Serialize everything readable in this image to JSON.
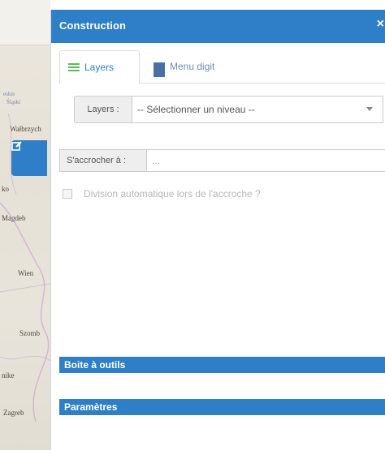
{
  "panel": {
    "title": "Construction",
    "close": "×"
  },
  "tabs": [
    {
      "label": "Layers",
      "icon": "layers-icon",
      "active": true
    },
    {
      "label": "Menu digit",
      "icon": "grid-icon",
      "active": false
    }
  ],
  "layers_field": {
    "label": "Layers :",
    "selected": "-- Sélectionner un niveau --"
  },
  "snap_field": {
    "label": "S'accrocher à :",
    "value": "..."
  },
  "auto_split": {
    "label": "Division automatique lors de l'accroche ?",
    "checked": false
  },
  "sections": {
    "toolbox": "Boite à outils",
    "params": "Paramètres"
  },
  "map": {
    "labels": [
      "Wałbrzych",
      "ko",
      "Magdeb",
      "Wien",
      "Szomb",
      "nike",
      "Zagreb"
    ],
    "tile_text": [
      "eskie",
      "Śląski"
    ],
    "edit_icon": "edit-icon"
  },
  "colors": {
    "accent": "#2f7fc8",
    "tab_green": "#5cb85c"
  }
}
